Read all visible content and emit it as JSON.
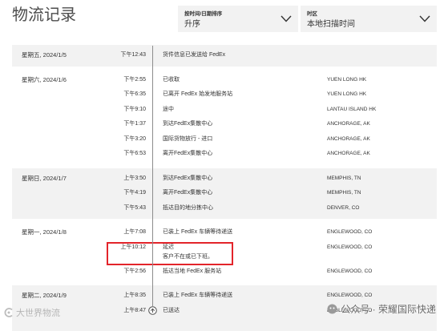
{
  "page_title": "物流记录",
  "sort": {
    "label": "按时间/日期排序",
    "value": "升序",
    "icon": "chevron-down-icon"
  },
  "timezone": {
    "label": "时区",
    "value": "本地扫描时间",
    "icon": "chevron-down-icon"
  },
  "groups": [
    {
      "date": "星期五, 2024/1/5",
      "events": [
        {
          "time": "下午12:43",
          "desc": "货件信息已发送给 FedEx"
        }
      ]
    },
    {
      "date": "星期六, 2024/1/6",
      "events": [
        {
          "time": "下午2:55",
          "desc": "已收取",
          "location": "YUEN LONG HK"
        },
        {
          "time": "下午6:35",
          "desc": "已离开 FedEx 始发地服务站",
          "location": "YUEN LONG HK"
        },
        {
          "time": "下午9:10",
          "desc": "途中",
          "location": "LANTAU ISLAND HK"
        },
        {
          "time": "下午1:37",
          "desc": "到达FedEx集散中心",
          "location": "ANCHORAGE, AK"
        },
        {
          "time": "下午3:20",
          "desc": "国际货物放行 - 进口",
          "location": "ANCHORAGE, AK"
        },
        {
          "time": "下午6:53",
          "desc": "离开FedEx集散中心",
          "location": "ANCHORAGE, AK"
        }
      ]
    },
    {
      "date": "星期日, 2024/1/7",
      "events": [
        {
          "time": "上午3:50",
          "desc": "到达FedEx集散中心",
          "location": "MEMPHIS, TN"
        },
        {
          "time": "下午4:19",
          "desc": "离开FedEx集散中心",
          "location": "MEMPHIS, TN"
        },
        {
          "time": "下午5:43",
          "desc": "抵达目的地分拣中心",
          "location": "DENVER, CO"
        }
      ]
    },
    {
      "date": "星期一, 2024/1/8",
      "events": [
        {
          "time": "上午7:08",
          "desc": "已装上 FedEx 车辆等待递送",
          "location": "ENGLEWOOD, CO"
        },
        {
          "time": "上午10:12",
          "desc": "延迟",
          "note": "客户不在或已下班。",
          "location": "ENGLEWOOD, CO",
          "highlighted": true
        },
        {
          "time": "下午2:56",
          "desc": "抵达当地 FedEx 服务站",
          "location": "ENGLEWOOD, CO"
        }
      ]
    },
    {
      "date": "星期二, 2024/1/9",
      "events": [
        {
          "time": "上午8:35",
          "desc": "已装上 FedEx 车辆等待递送",
          "location": "ENGLEWOOD, CO"
        },
        {
          "time": "上午8:47",
          "desc": "已送达",
          "location": "ENGLEWOOD, CO",
          "icon": "delivered-icon"
        }
      ]
    }
  ],
  "colors": {
    "row_shade": "#f2f2f2",
    "highlight": "#e3242b",
    "timeline": "#8c8c8c",
    "text": "#333333"
  },
  "watermarks": {
    "left": "大世界物流",
    "right": "公众号 · 荣耀国际快递"
  }
}
